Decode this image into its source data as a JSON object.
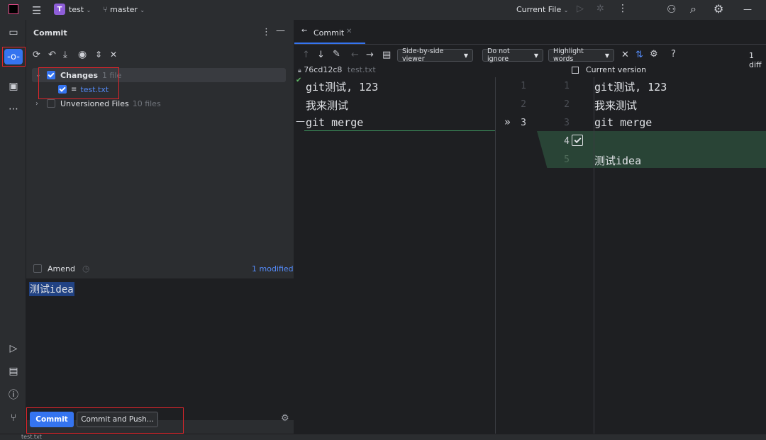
{
  "titlebar": {
    "project_badge": "T",
    "project_name": "test",
    "branch": "master",
    "run_config": "Current File"
  },
  "commit_panel": {
    "title": "Commit",
    "changes_label": "Changes",
    "changes_count": "1 file",
    "file_name": "test.txt",
    "unversioned_label": "Unversioned Files",
    "unversioned_count": "10 files",
    "amend_label": "Amend",
    "modified_status": "1 modified",
    "commit_message": "测试idea",
    "commit_button": "Commit",
    "commit_push_button": "Commit and Push..."
  },
  "diff": {
    "tab_label": "Commit",
    "viewer_mode": "Side-by-side viewer",
    "whitespace_mode": "Do not ignore",
    "highlight_mode": "Highlight words",
    "diff_count": "1 diff",
    "left_revision": "76cd12c8",
    "left_file": "test.txt",
    "right_title": "Current version",
    "left_lines": [
      {
        "num": "1",
        "text": "git测试, 123"
      },
      {
        "num": "2",
        "text": "我来测试"
      },
      {
        "num": "3",
        "text": "git merge"
      }
    ],
    "right_lines": [
      {
        "num": "1",
        "text": "git测试, 123"
      },
      {
        "num": "2",
        "text": "我来测试"
      },
      {
        "num": "3",
        "text": "git merge"
      },
      {
        "num": "4",
        "text": ""
      },
      {
        "num": "5",
        "text": "测试idea"
      }
    ]
  },
  "status_bar": {
    "file": "test.txt"
  },
  "colors": {
    "accent": "#3574f0",
    "added_bg": "#294436",
    "highlight": "#e0252b"
  }
}
